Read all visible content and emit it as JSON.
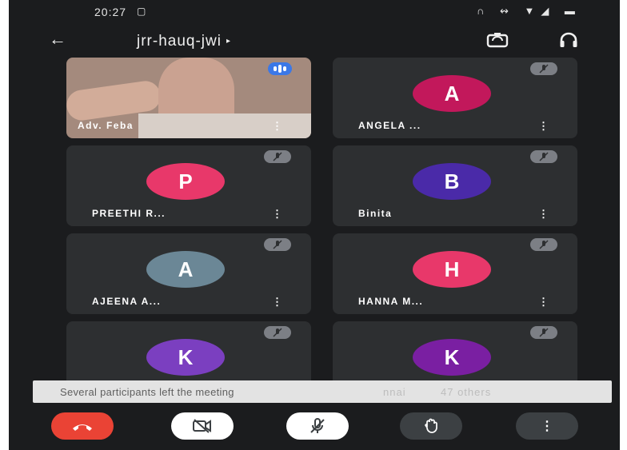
{
  "status_bar": {
    "time": "20:27",
    "notification_glyph": "▢",
    "icons": [
      "headset-icon",
      "vibrate-icon",
      "wifi-icon",
      "signal-icon",
      "battery-icon"
    ],
    "icons_text": "∩ ↭ ▼◢ ▬"
  },
  "app_bar": {
    "back_glyph": "←",
    "meeting_code": "jrr-hauq-jwi",
    "caret_glyph": "▸"
  },
  "participants": [
    {
      "name": "Adv. Feba",
      "initial": "",
      "avatar_color": "",
      "video_on": true,
      "speaking": true,
      "muted": false
    },
    {
      "name": "ANGELA ...",
      "initial": "A",
      "avatar_color": "#c2185b",
      "video_on": false,
      "muted": true
    },
    {
      "name": "PREETHI R...",
      "initial": "P",
      "avatar_color": "#e8386a",
      "video_on": false,
      "muted": true
    },
    {
      "name": "Binita",
      "initial": "B",
      "avatar_color": "#4a2aa8",
      "video_on": false,
      "muted": true
    },
    {
      "name": "AJEENA A...",
      "initial": "A",
      "avatar_color": "#6b8796",
      "video_on": false,
      "muted": true
    },
    {
      "name": "HANNA M...",
      "initial": "H",
      "avatar_color": "#e8386a",
      "video_on": false,
      "muted": true
    },
    {
      "name": "",
      "initial": "K",
      "avatar_color": "#7b3fc0",
      "video_on": false,
      "muted": true
    },
    {
      "name": "",
      "initial": "K",
      "avatar_color": "#7a1fa2",
      "video_on": false,
      "muted": true
    }
  ],
  "more_glyph": "⋮",
  "toast": {
    "message": "Several participants left the meeting",
    "behind_name": "nnai",
    "behind_others": "47 others"
  },
  "controls": {
    "end_call": {
      "icon": "phone-hangup-icon",
      "color": "#ea4335"
    },
    "camera": {
      "icon": "camera-off-icon",
      "color": "#ffffff"
    },
    "mic": {
      "icon": "mic-off-icon",
      "color": "#ffffff"
    },
    "raise_hand": {
      "icon": "hand-icon",
      "color": "#3c4043"
    },
    "more": {
      "icon": "more-vert-icon",
      "color": "#3c4043",
      "glyph": "⋮"
    }
  }
}
